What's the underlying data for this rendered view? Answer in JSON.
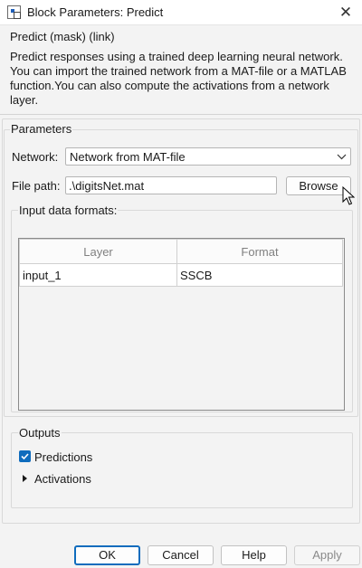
{
  "window": {
    "title": "Block Parameters: Predict",
    "close_glyph": "✕"
  },
  "header": {
    "mask_title": "Predict (mask) (link)",
    "description": "Predict responses using a trained deep learning neural network. You can import the trained network from a MAT-file or a MATLAB function.You can also compute the activations from a network layer."
  },
  "parameters": {
    "group_label": "Parameters",
    "network": {
      "label": "Network:",
      "value": "Network from MAT-file"
    },
    "file_path": {
      "label": "File path:",
      "value": ".\\digitsNet.mat"
    },
    "browse_label": "Browse",
    "input_formats": {
      "group_label": "Input data formats:",
      "columns": [
        "Layer",
        "Format"
      ],
      "rows": [
        {
          "layer": "input_1",
          "format": "SSCB"
        }
      ]
    }
  },
  "outputs": {
    "group_label": "Outputs",
    "predictions": {
      "label": "Predictions",
      "checked": true
    },
    "activations": {
      "label": "Activations",
      "expanded": false
    }
  },
  "buttons": {
    "ok": "OK",
    "cancel": "Cancel",
    "help": "Help",
    "apply": "Apply"
  },
  "colors": {
    "accent": "#0f6cbd",
    "background": "#f3f3f3"
  }
}
